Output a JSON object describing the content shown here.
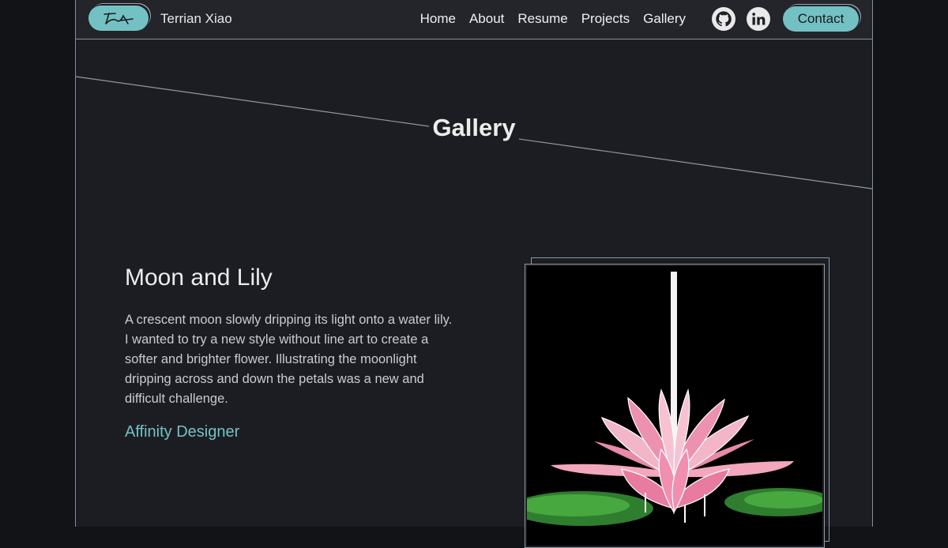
{
  "header": {
    "brand_name": "Terrian Xiao",
    "logo_icon": "signature-logo-icon",
    "nav": [
      {
        "label": "Home"
      },
      {
        "label": "About"
      },
      {
        "label": "Resume"
      },
      {
        "label": "Projects"
      },
      {
        "label": "Gallery"
      }
    ],
    "social_icons": [
      "github-icon",
      "linkedin-icon"
    ],
    "contact_label": "Contact"
  },
  "page": {
    "title": "Gallery"
  },
  "artwork": {
    "title": "Moon and Lily",
    "description": "A crescent moon slowly dripping its light onto a water lily. I wanted to try a new style without line art to create a softer and brighter flower. Illustrating the moonlight dripping across and down the petals was a new and difficult challenge.",
    "tool": "Affinity Designer"
  },
  "colors": {
    "accent": "#74c1c4",
    "background": "#1c1d22",
    "navbar": "#23252b",
    "outer": "#121316"
  }
}
